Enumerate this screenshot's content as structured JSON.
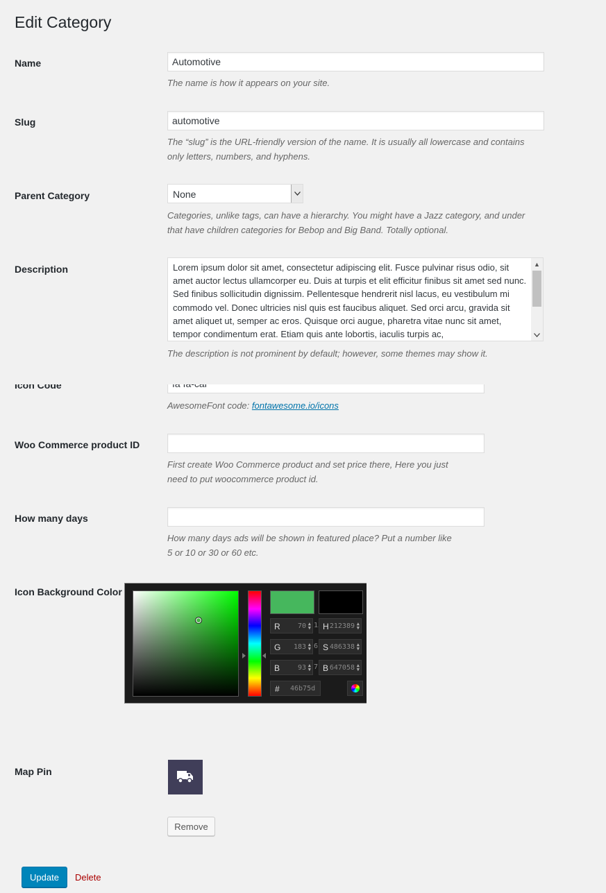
{
  "page": {
    "title": "Edit Category"
  },
  "fields": {
    "name": {
      "label": "Name",
      "value": "Automotive",
      "desc": "The name is how it appears on your site."
    },
    "slug": {
      "label": "Slug",
      "value": "automotive",
      "desc1": "The “slug” is the URL-friendly version of the name. It is usually all lowercase and contains",
      "desc2": "only letters, numbers, and hyphens."
    },
    "parent": {
      "label": "Parent Category",
      "selected": "None",
      "desc1": "Categories, unlike tags, can have a hierarchy. You might have a Jazz category, and under",
      "desc2": "that have children categories for Bebop and Big Band. Totally optional."
    },
    "description": {
      "label": "Description",
      "value": "Lorem ipsum dolor sit amet, consectetur adipiscing elit. Fusce pulvinar risus odio, sit amet auctor lectus ullamcorper eu. Duis at turpis et elit efficitur finibus sit amet sed nunc. Sed finibus sollicitudin dignissim. Pellentesque hendrerit nisl lacus, eu vestibulum mi commodo vel. Donec ultricies nisl quis est faucibus aliquet. Sed orci arcu, gravida sit amet aliquet ut, semper ac eros. Quisque orci augue, pharetra vitae nunc sit amet, tempor condimentum erat. Etiam quis ante lobortis, iaculis turpis ac,",
      "desc": "The description is not prominent by default; however, some themes may show it."
    },
    "icon_code": {
      "label": "Icon Code",
      "value": "fa fa-car",
      "desc_prefix": "AwesomeFont code: ",
      "link": "fontawesome.io/icons"
    },
    "product_id": {
      "label": "Woo Commerce product ID",
      "value": "",
      "desc1": "First create Woo Commerce product and set price there, Here you just",
      "desc2": "need to put woocommerce product id."
    },
    "days": {
      "label": "How many days",
      "value": "",
      "desc1": "How many days ads will be shown in featured place? Put a number like",
      "desc2": "5 or 10 or 30 or 60 etc."
    },
    "icon_bg": {
      "label": "Icon Background Color"
    },
    "map_pin": {
      "label": "Map Pin",
      "icon": "truck-icon"
    }
  },
  "color_picker": {
    "hue_color": "#00ff00",
    "new_color": "#46b75d",
    "old_color": "#000000",
    "cursor": {
      "saturation": 0.62,
      "value": 0.72
    },
    "r": {
      "key": "R",
      "value": "70"
    },
    "g": {
      "key": "G",
      "value": "183"
    },
    "b": {
      "key": "B",
      "value": "93"
    },
    "h": {
      "key": "H",
      "value": "212389",
      "overlap": "13"
    },
    "s": {
      "key": "S",
      "value": "486338",
      "overlap": "61"
    },
    "bv": {
      "key": "B",
      "value": "647058",
      "overlap": "71"
    },
    "hex": {
      "key": "#",
      "value": "46b75d"
    }
  },
  "buttons": {
    "remove": "Remove",
    "update": "Update",
    "delete": "Delete"
  },
  "colors": {
    "primary": "#0085ba",
    "delete": "#a00000",
    "pin_bg": "#403e59"
  }
}
